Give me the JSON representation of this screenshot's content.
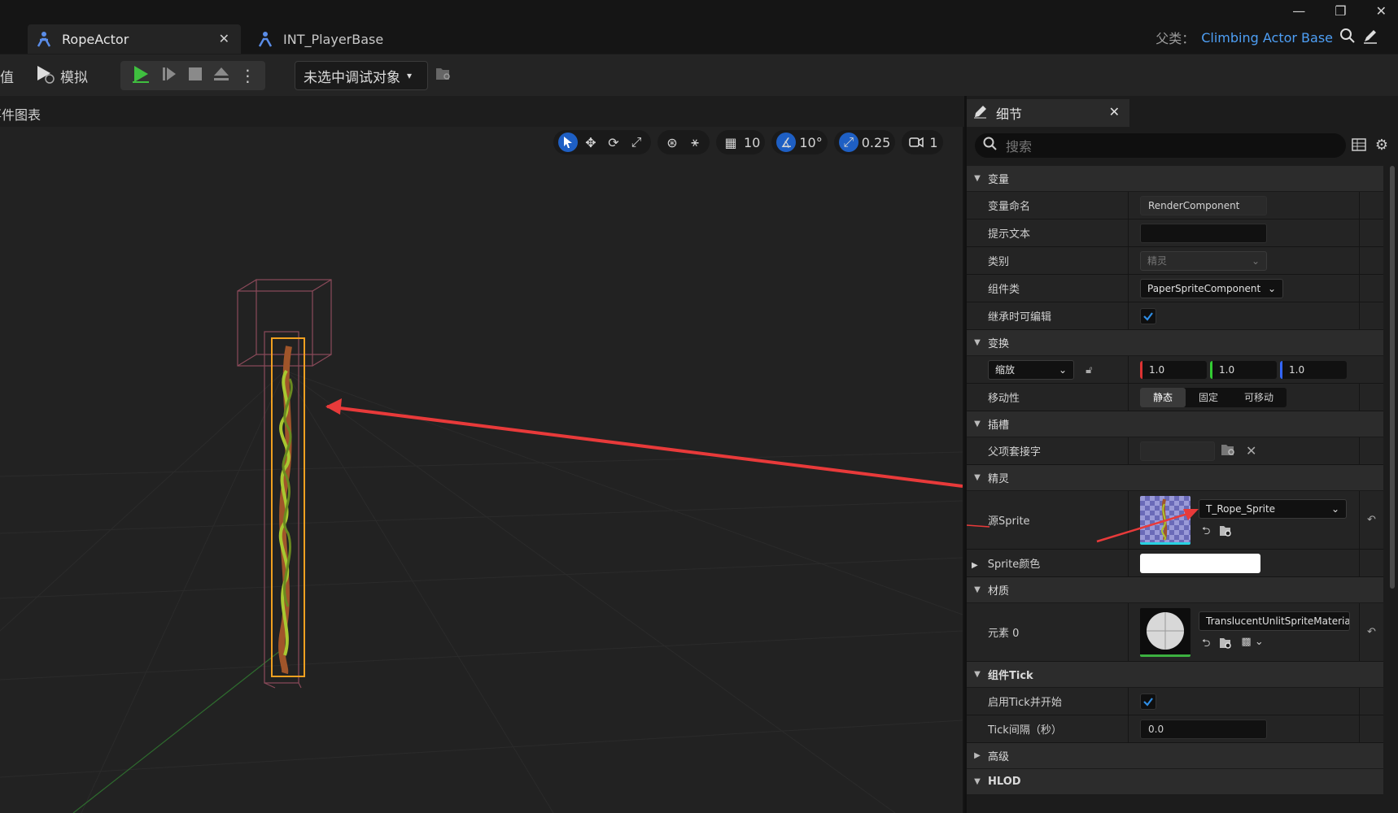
{
  "window": {
    "tabs": [
      {
        "label": "RopeActor",
        "active": true
      },
      {
        "label": "INT_PlayerBase",
        "active": false
      }
    ],
    "parent_class_label": "父类：",
    "parent_class_value": "Climbing Actor Base"
  },
  "toolbar": {
    "value_label": "值",
    "simulate_label": "模拟",
    "debug_dropdown": "未选中调试对象"
  },
  "graph": {
    "title": "事件图表"
  },
  "viewport_toolbar": {
    "grid_snap": "10",
    "rotation_snap": "10°",
    "scale_snap": "0.25",
    "camera_speed": "1"
  },
  "details": {
    "tab_label": "细节",
    "search_placeholder": "搜索",
    "sections": {
      "variables": "变量",
      "transform": "变换",
      "sockets": "插槽",
      "sprite": "精灵",
      "materials": "材质",
      "component_tick": "组件Tick",
      "advanced": "高级",
      "hlod": "HLOD"
    },
    "rows": {
      "variable_name_label": "变量命名",
      "variable_name_value": "RenderComponent",
      "tooltip_label": "提示文本",
      "tooltip_value": "",
      "category_label": "类别",
      "category_value": "精灵",
      "component_class_label": "组件类",
      "component_class_value": "PaperSpriteComponent",
      "editable_label": "继承时可编辑",
      "scale_mode": "缩放",
      "scale_x": "1.0",
      "scale_y": "1.0",
      "scale_z": "1.0",
      "mobility_label": "移动性",
      "mobility_static": "静态",
      "mobility_stationary": "固定",
      "mobility_movable": "可移动",
      "parent_socket_label": "父项套接字",
      "source_sprite_label": "源Sprite",
      "source_sprite_value": "T_Rope_Sprite",
      "sprite_color_label": "Sprite颜色",
      "element0_label": "元素 0",
      "element0_value": "TranslucentUnlitSpriteMaterial",
      "tick_enabled_label": "启用Tick并开始",
      "tick_interval_label": "Tick间隔（秒）",
      "tick_interval_value": "0.0"
    }
  },
  "colors": {
    "accent_blue": "#4e9ff5",
    "play_green": "#3fbf3f",
    "annotation_red": "#e83a3a",
    "selection_orange": "#f0a020"
  }
}
